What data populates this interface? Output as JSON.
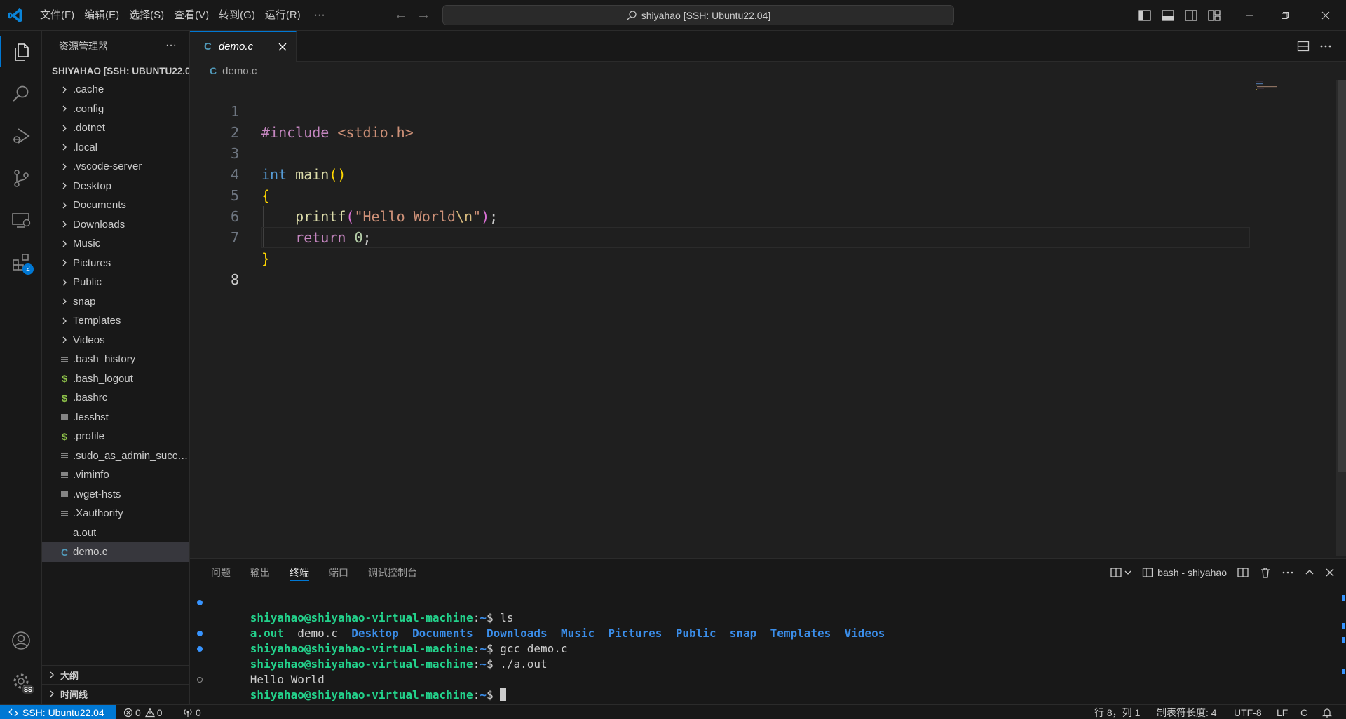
{
  "titlebar": {
    "menu": [
      "文件(F)",
      "编辑(E)",
      "选择(S)",
      "查看(V)",
      "转到(G)",
      "运行(R)"
    ],
    "more": "···",
    "search": "shiyahao [SSH: Ubuntu22.04]"
  },
  "activitybar": {
    "extensions_badge": "2",
    "account_badge": "SS"
  },
  "sidebar": {
    "title": "资源管理器",
    "more": "···",
    "root": "SHIYAHAO [SSH: UBUNTU22.04]",
    "items": [
      {
        "type": "folder",
        "name": ".cache"
      },
      {
        "type": "folder",
        "name": ".config"
      },
      {
        "type": "folder",
        "name": ".dotnet"
      },
      {
        "type": "folder",
        "name": ".local"
      },
      {
        "type": "folder",
        "name": ".vscode-server"
      },
      {
        "type": "folder",
        "name": "Desktop"
      },
      {
        "type": "folder",
        "name": "Documents"
      },
      {
        "type": "folder",
        "name": "Downloads"
      },
      {
        "type": "folder",
        "name": "Music"
      },
      {
        "type": "folder",
        "name": "Pictures"
      },
      {
        "type": "folder",
        "name": "Public"
      },
      {
        "type": "folder",
        "name": "snap"
      },
      {
        "type": "folder",
        "name": "Templates"
      },
      {
        "type": "folder",
        "name": "Videos"
      },
      {
        "type": "text",
        "name": ".bash_history"
      },
      {
        "type": "shell",
        "name": ".bash_logout"
      },
      {
        "type": "shell",
        "name": ".bashrc"
      },
      {
        "type": "text",
        "name": ".lesshst"
      },
      {
        "type": "shell",
        "name": ".profile"
      },
      {
        "type": "text",
        "name": ".sudo_as_admin_successful"
      },
      {
        "type": "text",
        "name": ".viminfo"
      },
      {
        "type": "text",
        "name": ".wget-hsts"
      },
      {
        "type": "text",
        "name": ".Xauthority"
      },
      {
        "type": "binary",
        "name": "a.out"
      },
      {
        "type": "c",
        "name": "demo.c",
        "selected": true
      }
    ],
    "sections": {
      "outline": "大纲",
      "timeline": "时间线"
    }
  },
  "editor": {
    "tab": {
      "icon": "C",
      "label": "demo.c"
    },
    "breadcrumb": {
      "icon": "C",
      "file": "demo.c"
    },
    "line_numbers": [
      "1",
      "2",
      "3",
      "4",
      "5",
      "6",
      "7",
      "8"
    ],
    "current_line": 8,
    "code": {
      "l1_pre": "#include",
      "l1_inc": " <stdio.h>",
      "l3_type": "int",
      "l3_fn": " main",
      "l3_paren": "()",
      "l4_brace": "{",
      "l5_fn": "    printf",
      "l5_open": "(",
      "l5_str1": "\"Hello World",
      "l5_esc": "\\n",
      "l5_str2": "\"",
      "l5_close": ")",
      "l5_semi": ";",
      "l6_kw": "    return",
      "l6_num": " 0",
      "l6_semi": ";",
      "l7_brace": "}"
    }
  },
  "panel": {
    "tabs": [
      "问题",
      "输出",
      "终端",
      "端口",
      "调试控制台"
    ],
    "active_tab": "终端",
    "terminal_label": "bash - shiyahao",
    "terminal": {
      "prompt_user": "shiyahao@shiyahao-virtual-machine",
      "prompt_sep": ":",
      "prompt_path": "~",
      "prompt_end": "$ ",
      "cmd1": "ls",
      "ls_aout": "a.out",
      "ls_democ": "demo.c",
      "ls_dirs": [
        "Desktop",
        "Documents",
        "Downloads",
        "Music",
        "Pictures",
        "Public",
        "snap",
        "Templates",
        "Videos"
      ],
      "cmd2": "gcc demo.c",
      "cmd3": "./a.out",
      "output": "Hello World"
    }
  },
  "statusbar": {
    "remote": "SSH: Ubuntu22.04",
    "errors": "0",
    "warnings": "0",
    "ports": "0",
    "position": "行 8，列 1",
    "tab_size": "制表符长度: 4",
    "encoding": "UTF-8",
    "eol": "LF",
    "language": "C"
  },
  "colors": {
    "accent": "#0078d4",
    "background": "#1f1f1f",
    "chrome": "#181818"
  }
}
